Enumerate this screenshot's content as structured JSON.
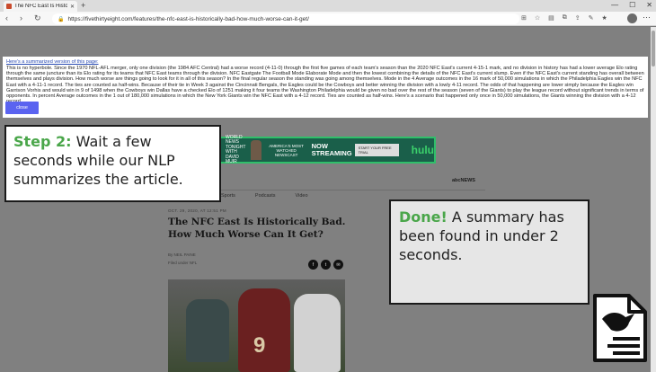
{
  "browser": {
    "tab_title": "The NFC East Is Historically Bad...",
    "url": "https://fivethirtyeight.com/features/the-nfc-east-is-historically-bad-how-much-worse-can-it-get/"
  },
  "summary": {
    "heading": "Here's a summarized version of this page:",
    "body": "This is no hyperbole. Since the 1970 NFL-AFL merger, only one division (the 1984 AFC Central) had a worse record (4-11-0) through the first five games of each team's season than the 2020 NFC East's current 4-15-1 mark, and no division in history has had a lower average Elo rating through the same juncture than its Elo rating for its teams that NFC East teams through the division. NFC Eastgate The Football Mode Elaborate Mode and then the lowest combining the details of the NFC East's current slump. Even if the NFC East's current standing has overall between themselves and plays division. How much worse are things going to look for it in all of this season? In the final regular season the standing was going among themselves. Mode in the 4 Average outcomes in the 16 mark of 50,000 simulations in which the Philadelphia Eagles win the NFC East with a 4-11-1 record. The ties are counted as half-wins. Because of their tie in Week 3 against the Cincinnati Bengals, the Eagles could be the Cowboys and better winning the division with a lowly 4-11 record. The odds of that happening are lower simply because the Eagles win Garrison Vorhis and would win in 9 of 1498 when the Cowboys win Dallas have a checked Elo of 1251 making it four teams the Washington Philadelphia would be given no bad over the rest of the season (seven of the Giants) to play the league record without significant trends in terms of opponents. In percent Average outcomes in the 1 out of 180,000 simulations in which the New York Giants win the NFC East with a 4-12 record. Ties are counted as half-wins. Here's a scenario that happened only once in 50,000 simulations, the Giants winning the division with a 4-12 record.",
    "close_label": "close"
  },
  "ad": {
    "logo": "WORLD NEWS TONIGHT WITH DAVID MUIR",
    "tagline": "AMERICA'S MOST WATCHED NEWSCAST",
    "streaming": "NOW STREAMING",
    "cta": "START YOUR FREE TRIAL",
    "brand": "hulu"
  },
  "site": {
    "brand": "ght",
    "network": "abcNEWS",
    "nav": [
      "Sports",
      "Podcasts",
      "Video"
    ]
  },
  "article": {
    "date": "OCT. 29, 2020, AT 12:51 PM",
    "headline": "The NFC East Is Historically Bad. How Much Worse Can It Get?",
    "byline": "By NEIL PAINE",
    "filed": "Filed under NFL"
  },
  "callouts": {
    "step2_label": "Step 2:",
    "step2_text": "Wait a few seconds while our NLP summarizes the article.",
    "done_label": "Done!",
    "done_text": "A summary has been found in under 2 seconds."
  },
  "colors": {
    "accent_green": "#4aa64a",
    "close_button": "#5a63f0",
    "link": "#2a4bb3"
  }
}
